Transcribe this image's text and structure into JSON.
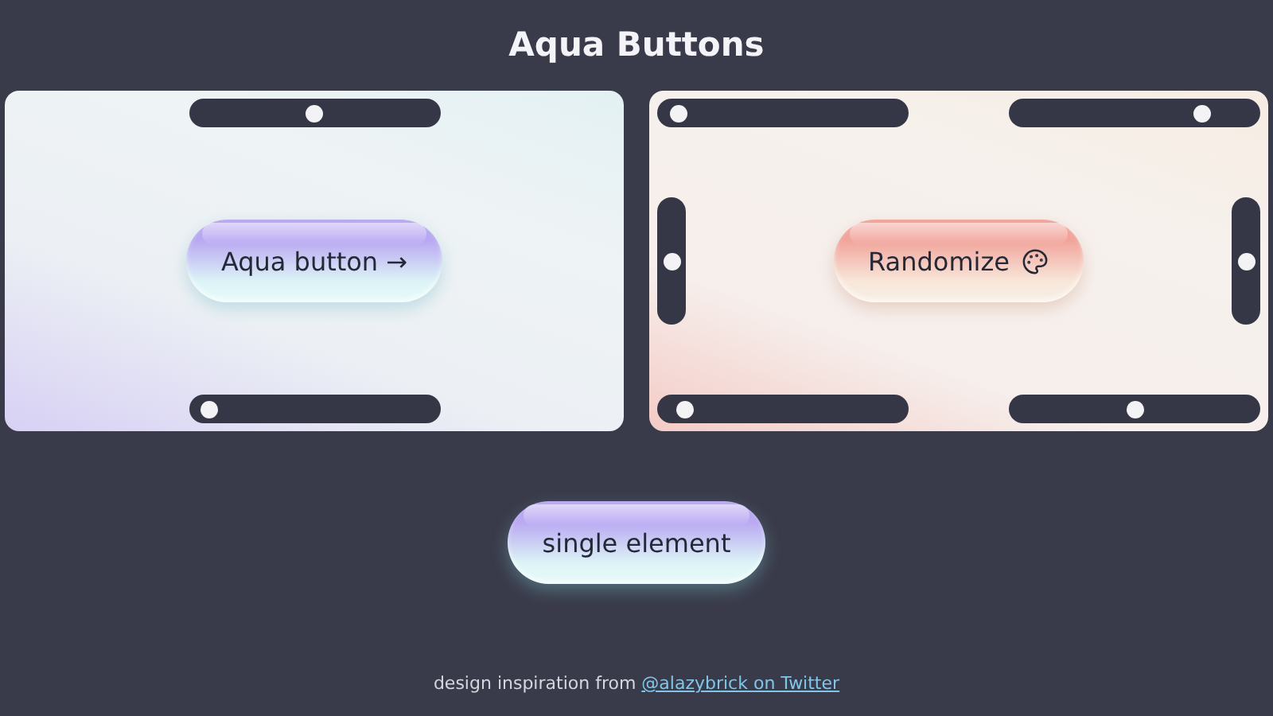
{
  "title": "Aqua Buttons",
  "panels": [
    {
      "button": {
        "label": "Aqua button →",
        "color": "#b9a8f2",
        "palette_icon": false
      },
      "top_sliders": [
        {
          "level": 0.5
        }
      ],
      "bottom_sliders": [
        {
          "level": 0.03
        }
      ]
    },
    {
      "button": {
        "label": "Randomize",
        "color": "#f1a49b",
        "palette_icon": true
      },
      "top_sliders": [
        {
          "level": 0.03
        },
        {
          "level": 0.8
        }
      ],
      "side_sliders": [
        {
          "level": 0.5
        },
        {
          "level": 0.5
        }
      ],
      "bottom_sliders": [
        {
          "level": 0.06
        },
        {
          "level": 0.5
        }
      ]
    }
  ],
  "single_button": {
    "label": "single element",
    "color": "#b9a8f2"
  },
  "footer": {
    "text": "design inspiration from",
    "link": "@alazybrick on Twitter"
  }
}
